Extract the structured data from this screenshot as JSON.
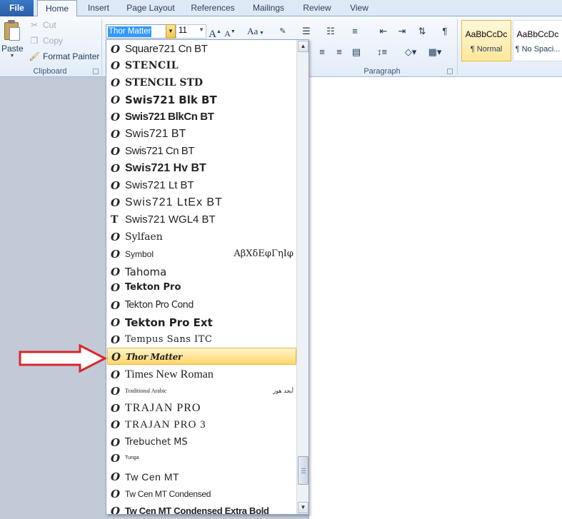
{
  "tabs": {
    "file": "File",
    "home": "Home",
    "insert": "Insert",
    "page_layout": "Page Layout",
    "references": "References",
    "mailings": "Mailings",
    "review": "Review",
    "view": "View"
  },
  "clipboard": {
    "paste": "Paste",
    "cut": "Cut",
    "copy": "Copy",
    "format_painter": "Format Painter",
    "group_label": "Clipboard"
  },
  "font_group": {
    "font_name": "Thor Matter",
    "font_size": "11",
    "change_case": "Aa"
  },
  "paragraph": {
    "group_label": "Paragraph",
    "pilcrow": "¶"
  },
  "styles": [
    {
      "sample": "AaBbCcDc",
      "name": "¶ Normal",
      "selected": true
    },
    {
      "sample": "AaBbCcDc",
      "name": "¶ No Spaci...",
      "selected": false
    }
  ],
  "font_list": [
    {
      "name": "Square721 Cn BT",
      "icon": "opentype-icon",
      "sample": ""
    },
    {
      "name": "STENCIL",
      "icon": "opentype-icon",
      "sample": ""
    },
    {
      "name": "STENCIL STD",
      "icon": "opentype-icon",
      "sample": ""
    },
    {
      "name": "Swis721 Blk BT",
      "icon": "opentype-icon",
      "sample": ""
    },
    {
      "name": "Swis721 BlkCn BT",
      "icon": "opentype-icon",
      "sample": ""
    },
    {
      "name": "Swis721 BT",
      "icon": "opentype-icon",
      "sample": ""
    },
    {
      "name": "Swis721 Cn BT",
      "icon": "opentype-icon",
      "sample": ""
    },
    {
      "name": "Swis721 Hv BT",
      "icon": "opentype-icon",
      "sample": ""
    },
    {
      "name": "Swis721 Lt BT",
      "icon": "opentype-icon",
      "sample": ""
    },
    {
      "name": "Swis721 LtEx BT",
      "icon": "opentype-icon",
      "sample": ""
    },
    {
      "name": "Swis721 WGL4 BT",
      "icon": "truetype-icon",
      "sample": ""
    },
    {
      "name": "Sylfaen",
      "icon": "opentype-icon",
      "sample": ""
    },
    {
      "name": "Symbol",
      "icon": "opentype-icon",
      "sample": "ΑβΧδΕφΓηΙφ"
    },
    {
      "name": "Tahoma",
      "icon": "opentype-icon",
      "sample": ""
    },
    {
      "name": "Tekton Pro",
      "icon": "opentype-icon",
      "sample": ""
    },
    {
      "name": "Tekton Pro Cond",
      "icon": "opentype-icon",
      "sample": ""
    },
    {
      "name": "Tekton Pro Ext",
      "icon": "opentype-icon",
      "sample": ""
    },
    {
      "name": "Tempus Sans ITC",
      "icon": "opentype-icon",
      "sample": ""
    },
    {
      "name": "Thor Matter",
      "icon": "opentype-icon",
      "sample": "",
      "highlighted": true
    },
    {
      "name": "Times New Roman",
      "icon": "opentype-icon",
      "sample": ""
    },
    {
      "name": "Traditional Arabic",
      "icon": "opentype-icon",
      "sample": "أيجد هوز"
    },
    {
      "name": "TRAJAN PRO",
      "icon": "opentype-icon",
      "sample": ""
    },
    {
      "name": "TRAJAN PRO 3",
      "icon": "opentype-icon",
      "sample": ""
    },
    {
      "name": "Trebuchet MS",
      "icon": "opentype-icon",
      "sample": ""
    },
    {
      "name": "Tunga",
      "icon": "opentype-icon",
      "sample": ""
    },
    {
      "name": "Tw Cen MT",
      "icon": "opentype-icon",
      "sample": ""
    },
    {
      "name": "Tw Cen MT Condensed",
      "icon": "opentype-icon",
      "sample": ""
    },
    {
      "name": "Tw Cen MT Condensed Extra Bold",
      "icon": "opentype-icon",
      "sample": ""
    }
  ],
  "colors": {
    "annotation_arrow": "#d9262b",
    "highlight": "#ffd76a"
  }
}
